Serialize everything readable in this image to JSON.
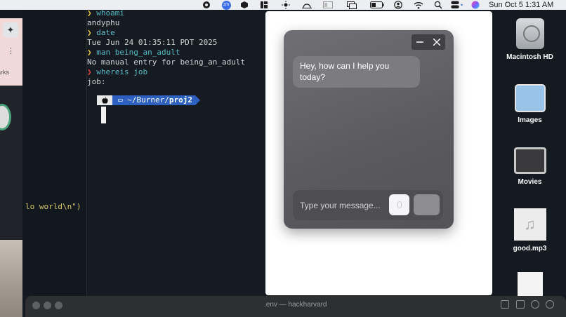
{
  "menubar": {
    "icons": [
      "record-icon",
      "zoom-icon",
      "box-icon",
      "grid-icon",
      "brightness-icon",
      "sunrise-icon",
      "dots-grid-icon",
      "window-icon",
      "battery-icon",
      "user-circle-icon",
      "wifi-icon",
      "search-icon",
      "control-center-icon",
      "siri-icon"
    ],
    "zoom_label": "zm",
    "clock": "Sun Oct 5  1:31 AM"
  },
  "left_strip": {
    "partial_text": "arks"
  },
  "editor": {
    "code_fragment": "lo world\\n\")"
  },
  "terminal": {
    "lines": [
      {
        "prompt": "❯",
        "cmd": "whoami"
      },
      {
        "out": "andyphu"
      },
      {
        "prompt": "❯",
        "cmd": "date"
      },
      {
        "out": "Tue Jun 24 01:35:11 PDT 2025"
      },
      {
        "prompt": "❯",
        "cmd": "man being_an_adult"
      },
      {
        "out": "No manual entry for being_an_adult"
      },
      {
        "prompt": "❯",
        "cmd": "whereis job"
      },
      {
        "out": "job:"
      }
    ],
    "path_prefix": "~/Burner/",
    "path_dir": "proj2"
  },
  "chat": {
    "greeting": "Hey, how can I help you today?",
    "input_placeholder": "Type your message...",
    "input_value": ""
  },
  "desktop": {
    "items": [
      {
        "label": "Macintosh HD"
      },
      {
        "label": "Images"
      },
      {
        "label": "Movies"
      },
      {
        "label": "good.mp3"
      }
    ]
  },
  "bottombar": {
    "title": ".env — hackharvard"
  }
}
